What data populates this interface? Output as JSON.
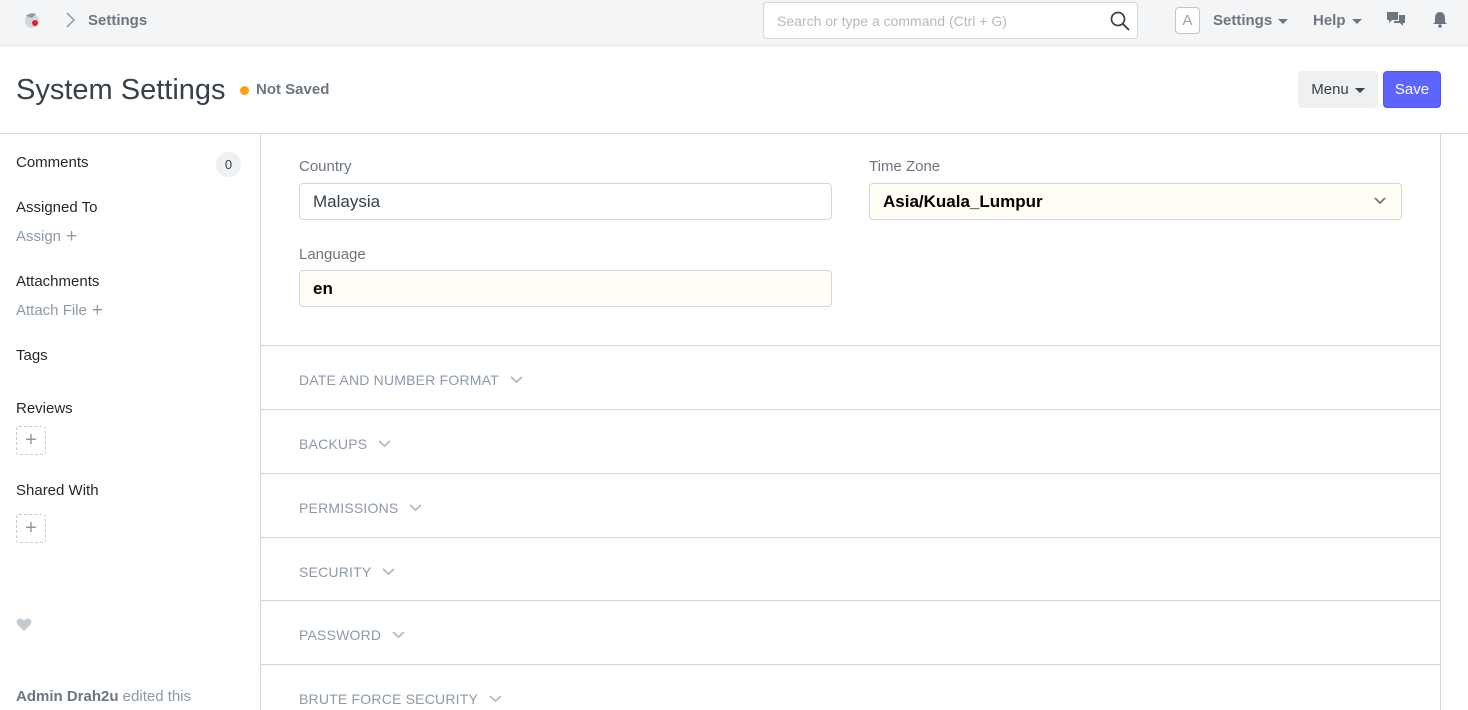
{
  "navbar": {
    "breadcrumb": "Settings",
    "search_placeholder": "Search or type a command (Ctrl + G)",
    "avatar_letter": "A",
    "settings_label": "Settings",
    "help_label": "Help"
  },
  "page": {
    "title": "System Settings",
    "status": "Not Saved",
    "status_color": "#ff9f0e",
    "menu_label": "Menu",
    "save_label": "Save",
    "accent": "#5e64ff"
  },
  "sidebar": {
    "comments_label": "Comments",
    "comments_count": "0",
    "assigned_to_label": "Assigned To",
    "assign_link": "Assign",
    "attachments_label": "Attachments",
    "attach_link": "Attach File",
    "tags_label": "Tags",
    "reviews_label": "Reviews",
    "shared_with_label": "Shared With",
    "activity_user": "Admin Drah2u",
    "activity_text": " edited this"
  },
  "form": {
    "country_label": "Country",
    "country_value": "Malaysia",
    "timezone_label": "Time Zone",
    "timezone_value": "Asia/Kuala_Lumpur",
    "language_label": "Language",
    "language_value": "en",
    "sections": [
      "DATE AND NUMBER FORMAT",
      "BACKUPS",
      "PERMISSIONS",
      "SECURITY",
      "PASSWORD",
      "BRUTE FORCE SECURITY"
    ]
  }
}
